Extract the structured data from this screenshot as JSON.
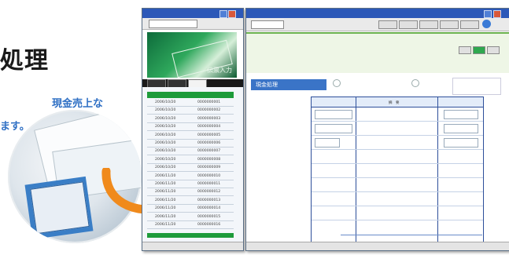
{
  "headline": "処理",
  "lead_lines": [
    "現金売上な",
    "ます。"
  ],
  "colors": {
    "accent": "#2e6fc4",
    "window_title": "#2c58b8",
    "grid_border": "#2d4f9a",
    "list_header": "#1d9b3a",
    "arrow": "#f08a1c"
  },
  "left_window": {
    "banner_text": "伝票入力",
    "tabs": [
      "",
      "",
      ""
    ],
    "list_header": [
      "",
      ""
    ],
    "rows": [
      [
        "2006/10/20",
        "0000000001"
      ],
      [
        "2006/10/20",
        "0000000002"
      ],
      [
        "2006/10/20",
        "0000000003"
      ],
      [
        "2006/10/20",
        "0000000004"
      ],
      [
        "2006/10/20",
        "0000000005"
      ],
      [
        "2006/10/20",
        "0000000006"
      ],
      [
        "2006/10/20",
        "0000000007"
      ],
      [
        "2006/10/20",
        "0000000008"
      ],
      [
        "2006/10/20",
        "0000000009"
      ],
      [
        "2006/11/20",
        "0000000010"
      ],
      [
        "2006/11/20",
        "0000000011"
      ],
      [
        "2006/11/20",
        "0000000012"
      ],
      [
        "2006/11/20",
        "0000000013"
      ],
      [
        "2006/11/20",
        "0000000014"
      ],
      [
        "2006/11/20",
        "0000000015"
      ],
      [
        "2006/11/20",
        "0000000016"
      ]
    ]
  },
  "right_window": {
    "section_label": "現金処理",
    "grid_headers": [
      "",
      "摘　要",
      ""
    ],
    "grid_rows": [
      [
        "",
        "",
        ""
      ],
      [
        "",
        "",
        ""
      ],
      [
        "",
        "",
        ""
      ]
    ]
  }
}
